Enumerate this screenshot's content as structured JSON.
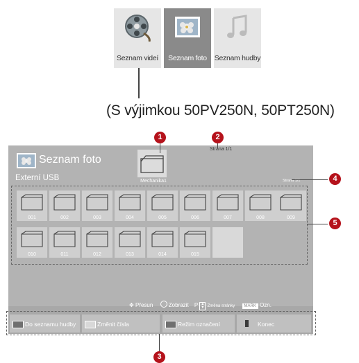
{
  "menu_tiles": [
    {
      "label": "Seznam videí",
      "icon": "film-reel-icon"
    },
    {
      "label": "Seznam foto",
      "icon": "photo-icon"
    },
    {
      "label": "Seznam hudby",
      "icon": "music-note-icon"
    }
  ],
  "exception_note": "(S výjimkou 50PV250N, 50PT250N)",
  "screen": {
    "title": "Seznam foto",
    "source": "Externí USB",
    "drive_label": "Mechanika1",
    "page_info_top": "Strana 1/1",
    "page_info_side": "Strana 1/1",
    "folders": [
      "001",
      "002",
      "003",
      "004",
      "005",
      "006",
      "007",
      "008",
      "009",
      "010",
      "011",
      "012",
      "013",
      "014",
      "015"
    ],
    "nav_hints": {
      "move": "Přesun",
      "view": "Zobrazit",
      "page_prefix": "P",
      "page_change": "Změna stránky",
      "mark_key": "MARK",
      "mark": "Ozn."
    },
    "buttons": [
      {
        "label": "Do seznamu hudby",
        "color": "#6f6f6f"
      },
      {
        "label": "Změnit čísla",
        "color": "#d8d8d8"
      },
      {
        "label": "Režim označení",
        "color": "#6f6f6f"
      },
      {
        "label": "Konec",
        "color": "#3a3a3a"
      }
    ]
  },
  "callouts": [
    "1",
    "2",
    "3",
    "4",
    "5"
  ],
  "colors": {
    "callout": "#b5121b",
    "screen_bg": "#b3b3b3"
  }
}
